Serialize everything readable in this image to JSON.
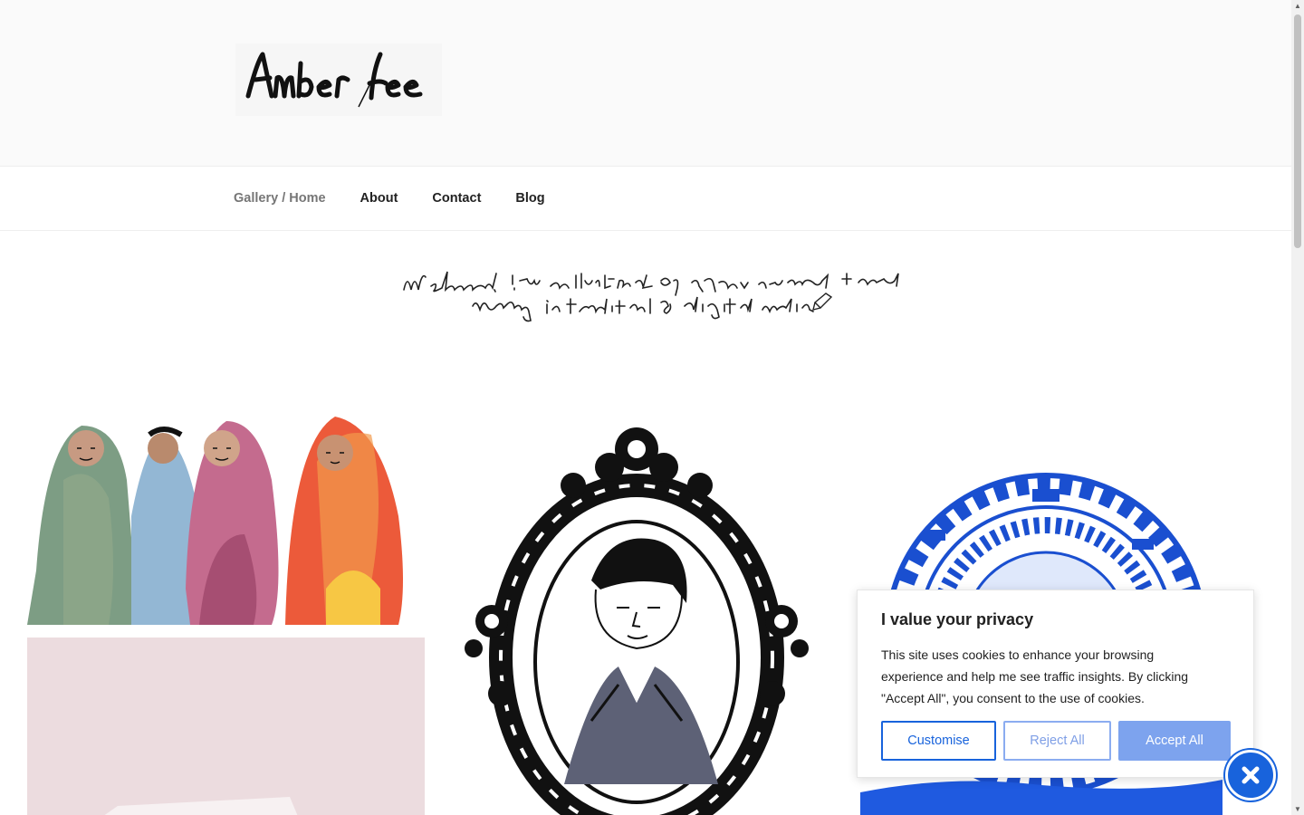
{
  "site": {
    "logo_text": "Amber Lee",
    "welcome_text": "Welcome! I'm an illustrator of people, ornaments + narrative working in traditional & digital media"
  },
  "nav": {
    "items": [
      {
        "label": "Gallery / Home",
        "current": true
      },
      {
        "label": "About"
      },
      {
        "label": "Contact"
      },
      {
        "label": "Blog"
      }
    ]
  },
  "cookie": {
    "title": "I value your privacy",
    "text": "This site uses cookies to enhance your browsing experience and help me see traffic insights. By clicking \"Accept All\", you consent to the use of cookies.",
    "customise_label": "Customise",
    "reject_label": "Reject All",
    "accept_label": "Accept All",
    "revisit_icon": "cookie-close-icon"
  },
  "colors": {
    "accent": "#1863dc",
    "accept_bg": "#7da3ee",
    "header_bg": "#fafafa"
  }
}
